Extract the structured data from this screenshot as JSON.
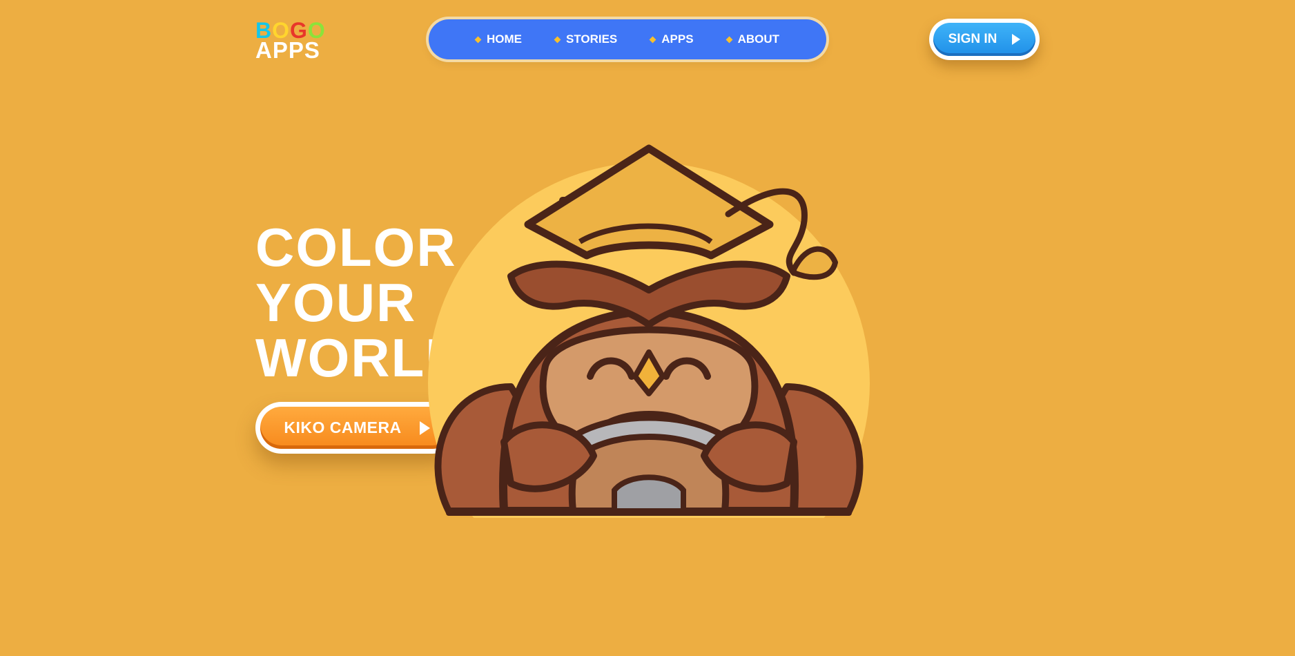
{
  "logo": {
    "letters": [
      "B",
      "O",
      "G",
      "O"
    ],
    "letter_colors": [
      "#16C6E8",
      "#FFD52E",
      "#E8362A",
      "#8BE33A"
    ],
    "bottom": "APPS"
  },
  "nav": {
    "items": [
      {
        "label": "HOME"
      },
      {
        "label": "STORIES"
      },
      {
        "label": "APPS"
      },
      {
        "label": "ABOUT"
      }
    ]
  },
  "header": {
    "signin_label": "SIGN IN"
  },
  "hero": {
    "headline": [
      "COLOR",
      "YOUR",
      "WORLD!"
    ],
    "cta_label": "KIKO CAMERA"
  },
  "colors": {
    "background": "#EDAE42",
    "nav": "#3F76F6",
    "signin": "#1F8FE8",
    "cta": "#F7891C"
  }
}
